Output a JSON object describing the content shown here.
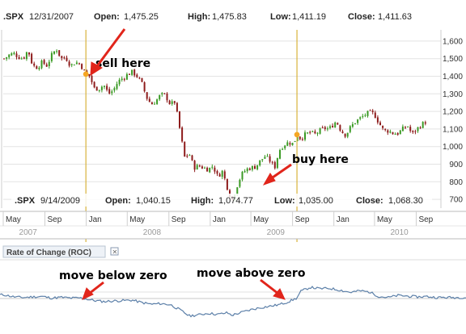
{
  "chart_data": {
    "type": "candlestick",
    "price_panel": {
      "header_top": {
        "symbol": ".SPX",
        "date": "12/31/2007",
        "open_label": "Open:",
        "open": "1,475.25",
        "high_label": "High:",
        "high": "1,475.83",
        "low_label": "Low:",
        "low": "1,411.19",
        "close_label": "Close:",
        "close": "1,411.63"
      },
      "header_bottom": {
        "symbol": ".SPX",
        "date": "9/14/2009",
        "open_label": "Open:",
        "open": "1,040.15",
        "high_label": "High:",
        "high": "1,074.77",
        "low_label": "Low:",
        "low": "1,035.00",
        "close_label": "Close:",
        "close": "1,068.30"
      },
      "ylim": [
        650,
        1650
      ],
      "yticks": [
        {
          "v": 700,
          "label": "700"
        },
        {
          "v": 800,
          "label": "800"
        },
        {
          "v": 900,
          "label": "900"
        },
        {
          "v": 1000,
          "label": "1,000"
        },
        {
          "v": 1100,
          "label": "1,100"
        },
        {
          "v": 1200,
          "label": "1,200"
        },
        {
          "v": 1300,
          "label": "1,300"
        },
        {
          "v": 1400,
          "label": "1,400"
        },
        {
          "v": 1500,
          "label": "1,500"
        },
        {
          "v": 1600,
          "label": "1,600"
        }
      ],
      "colors": {
        "up": "#3a9a24",
        "down": "#8e1c1c",
        "marker": "#f5a623",
        "vline": "#d8b33c",
        "grid": "#e3e3e3",
        "frame": "#bbbbbb"
      }
    },
    "x_axis": {
      "start": "2007-05-01",
      "end": "2010-11-01",
      "ticks": [
        {
          "date": "2007-05-01",
          "label": "May"
        },
        {
          "date": "2007-09-01",
          "label": "Sep"
        },
        {
          "date": "2008-01-01",
          "label": "Jan"
        },
        {
          "date": "2008-05-01",
          "label": "May"
        },
        {
          "date": "2008-09-01",
          "label": "Sep"
        },
        {
          "date": "2009-01-01",
          "label": "Jan"
        },
        {
          "date": "2009-05-01",
          "label": "May"
        },
        {
          "date": "2009-09-01",
          "label": "Sep"
        },
        {
          "date": "2010-01-01",
          "label": "Jan"
        },
        {
          "date": "2010-05-01",
          "label": "May"
        },
        {
          "date": "2010-09-01",
          "label": "Sep"
        }
      ],
      "years": [
        {
          "date": "2007-07-01",
          "label": "2007"
        },
        {
          "date": "2008-07-01",
          "label": "2008"
        },
        {
          "date": "2009-07-01",
          "label": "2009"
        },
        {
          "date": "2010-07-01",
          "label": "2010"
        }
      ]
    },
    "weekly_close": [
      [
        "2007-05-04",
        1500
      ],
      [
        "2007-05-18",
        1520
      ],
      [
        "2007-06-01",
        1530
      ],
      [
        "2007-06-15",
        1510
      ],
      [
        "2007-06-29",
        1500
      ],
      [
        "2007-07-13",
        1550
      ],
      [
        "2007-07-27",
        1460
      ],
      [
        "2007-08-10",
        1450
      ],
      [
        "2007-08-24",
        1480
      ],
      [
        "2007-09-07",
        1460
      ],
      [
        "2007-09-21",
        1520
      ],
      [
        "2007-10-05",
        1555
      ],
      [
        "2007-10-19",
        1500
      ],
      [
        "2007-11-02",
        1505
      ],
      [
        "2007-11-16",
        1460
      ],
      [
        "2007-11-30",
        1480
      ],
      [
        "2007-12-14",
        1470
      ],
      [
        "2007-12-31",
        1412
      ],
      [
        "2008-01-11",
        1400
      ],
      [
        "2008-01-25",
        1330
      ],
      [
        "2008-02-08",
        1330
      ],
      [
        "2008-02-22",
        1350
      ],
      [
        "2008-03-07",
        1300
      ],
      [
        "2008-03-21",
        1320
      ],
      [
        "2008-04-04",
        1370
      ],
      [
        "2008-04-18",
        1390
      ],
      [
        "2008-05-02",
        1410
      ],
      [
        "2008-05-16",
        1425
      ],
      [
        "2008-05-30",
        1400
      ],
      [
        "2008-06-13",
        1360
      ],
      [
        "2008-06-27",
        1280
      ],
      [
        "2008-07-11",
        1240
      ],
      [
        "2008-07-25",
        1260
      ],
      [
        "2008-08-08",
        1295
      ],
      [
        "2008-08-22",
        1290
      ],
      [
        "2008-09-05",
        1240
      ],
      [
        "2008-09-19",
        1255
      ],
      [
        "2008-10-03",
        1100
      ],
      [
        "2008-10-17",
        940
      ],
      [
        "2008-10-31",
        960
      ],
      [
        "2008-11-14",
        880
      ],
      [
        "2008-11-28",
        890
      ],
      [
        "2008-12-12",
        880
      ],
      [
        "2008-12-26",
        870
      ],
      [
        "2009-01-09",
        890
      ],
      [
        "2009-01-23",
        830
      ],
      [
        "2009-02-06",
        860
      ],
      [
        "2009-02-20",
        770
      ],
      [
        "2009-03-06",
        690
      ],
      [
        "2009-03-20",
        770
      ],
      [
        "2009-04-03",
        840
      ],
      [
        "2009-04-17",
        870
      ],
      [
        "2009-05-01",
        880
      ],
      [
        "2009-05-15",
        885
      ],
      [
        "2009-05-29",
        920
      ],
      [
        "2009-06-12",
        945
      ],
      [
        "2009-06-26",
        920
      ],
      [
        "2009-07-10",
        880
      ],
      [
        "2009-07-24",
        980
      ],
      [
        "2009-08-07",
        1010
      ],
      [
        "2009-08-21",
        1025
      ],
      [
        "2009-09-04",
        1015
      ],
      [
        "2009-09-14",
        1068
      ],
      [
        "2009-09-25",
        1045
      ],
      [
        "2009-10-09",
        1070
      ],
      [
        "2009-10-23",
        1080
      ],
      [
        "2009-11-06",
        1070
      ],
      [
        "2009-11-20",
        1090
      ],
      [
        "2009-12-04",
        1105
      ],
      [
        "2009-12-18",
        1100
      ],
      [
        "2010-01-08",
        1145
      ],
      [
        "2010-01-22",
        1090
      ],
      [
        "2010-02-05",
        1065
      ],
      [
        "2010-02-19",
        1110
      ],
      [
        "2010-03-05",
        1140
      ],
      [
        "2010-03-19",
        1160
      ],
      [
        "2010-04-02",
        1180
      ],
      [
        "2010-04-16",
        1195
      ],
      [
        "2010-04-30",
        1185
      ],
      [
        "2010-05-14",
        1135
      ],
      [
        "2010-05-28",
        1090
      ],
      [
        "2010-06-11",
        1090
      ],
      [
        "2010-06-25",
        1075
      ],
      [
        "2010-07-09",
        1075
      ],
      [
        "2010-07-23",
        1100
      ],
      [
        "2010-08-06",
        1120
      ],
      [
        "2010-08-20",
        1070
      ],
      [
        "2010-09-03",
        1100
      ],
      [
        "2010-09-17",
        1125
      ],
      [
        "2010-10-01",
        1145
      ],
      [
        "2010-10-15",
        1175
      ],
      [
        "2010-10-29",
        1185
      ]
    ],
    "roc_panel": {
      "title": "Rate of Change (ROC)",
      "ylim": [
        -1,
        1
      ],
      "zero": 0,
      "values": [
        [
          "2007-05-04",
          0.18
        ],
        [
          "2007-06-01",
          0.08
        ],
        [
          "2007-06-29",
          0.05
        ],
        [
          "2007-07-27",
          0.08
        ],
        [
          "2007-08-24",
          0.1
        ],
        [
          "2007-09-21",
          0.02
        ],
        [
          "2007-10-19",
          0.06
        ],
        [
          "2007-11-16",
          0.02
        ],
        [
          "2007-12-14",
          0.03
        ],
        [
          "2008-01-01",
          -0.02
        ],
        [
          "2008-01-25",
          -0.1
        ],
        [
          "2008-02-22",
          -0.15
        ],
        [
          "2008-03-21",
          -0.12
        ],
        [
          "2008-04-18",
          -0.1
        ],
        [
          "2008-05-16",
          -0.08
        ],
        [
          "2008-06-13",
          -0.2
        ],
        [
          "2008-07-11",
          -0.28
        ],
        [
          "2008-08-08",
          -0.25
        ],
        [
          "2008-09-05",
          -0.3
        ],
        [
          "2008-10-03",
          -0.55
        ],
        [
          "2008-10-31",
          -0.85
        ],
        [
          "2008-11-28",
          -0.8
        ],
        [
          "2008-12-26",
          -0.72
        ],
        [
          "2009-01-23",
          -0.78
        ],
        [
          "2009-02-20",
          -0.7
        ],
        [
          "2009-03-06",
          -0.82
        ],
        [
          "2009-04-03",
          -0.68
        ],
        [
          "2009-05-01",
          -0.55
        ],
        [
          "2009-05-29",
          -0.45
        ],
        [
          "2009-06-26",
          -0.38
        ],
        [
          "2009-07-24",
          -0.3
        ],
        [
          "2009-08-21",
          -0.15
        ],
        [
          "2009-09-14",
          0.02
        ],
        [
          "2009-09-25",
          0.35
        ],
        [
          "2009-10-23",
          0.55
        ],
        [
          "2009-11-20",
          0.48
        ],
        [
          "2009-12-18",
          0.5
        ],
        [
          "2010-01-22",
          0.4
        ],
        [
          "2010-02-19",
          0.3
        ],
        [
          "2010-03-19",
          0.38
        ],
        [
          "2010-04-16",
          0.32
        ],
        [
          "2010-05-14",
          0.1
        ],
        [
          "2010-06-11",
          0.05
        ],
        [
          "2010-07-09",
          0.15
        ],
        [
          "2010-08-06",
          0.12
        ],
        [
          "2010-09-03",
          0.08
        ],
        [
          "2010-10-01",
          0.1
        ],
        [
          "2010-10-29",
          0.05
        ]
      ]
    },
    "markers": [
      {
        "name": "sell",
        "date": "2007-12-31",
        "price": 1412
      },
      {
        "name": "buy",
        "date": "2009-09-14",
        "price": 1068
      }
    ],
    "annotations": {
      "sell": "sell here",
      "buy": "buy here",
      "below": "move below zero",
      "above": "move above zero"
    }
  }
}
